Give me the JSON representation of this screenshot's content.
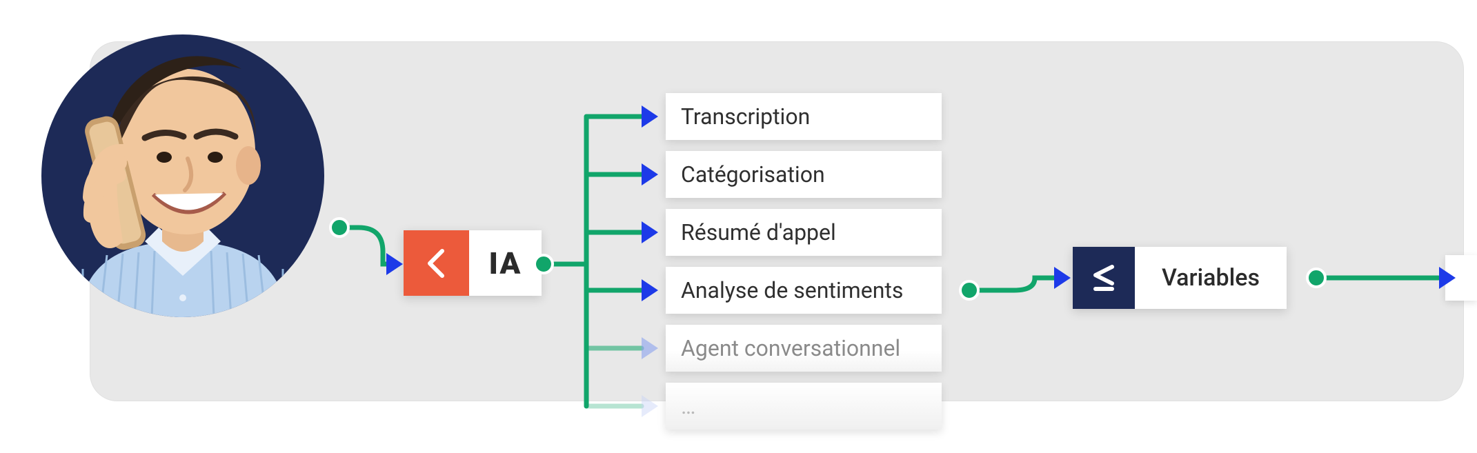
{
  "colors": {
    "panel_bg": "#e8e8e8",
    "avatar_bg": "#1d2a57",
    "accent_orange": "#ec5a3b",
    "accent_navy": "#1d2a57",
    "wire_green": "#11a56a",
    "arrow_blue": "#1d3ae8"
  },
  "ia_node": {
    "label": "IA",
    "icon": "chevron-left-icon"
  },
  "features": [
    "Transcription",
    "Catégorisation",
    "Résumé d'appel",
    "Analyse de sentiments",
    "Agent conversationnel",
    "…"
  ],
  "vars_node": {
    "label": "Variables",
    "icon": "less-equal-icon"
  },
  "avatar": {
    "description": "person-on-phone"
  }
}
